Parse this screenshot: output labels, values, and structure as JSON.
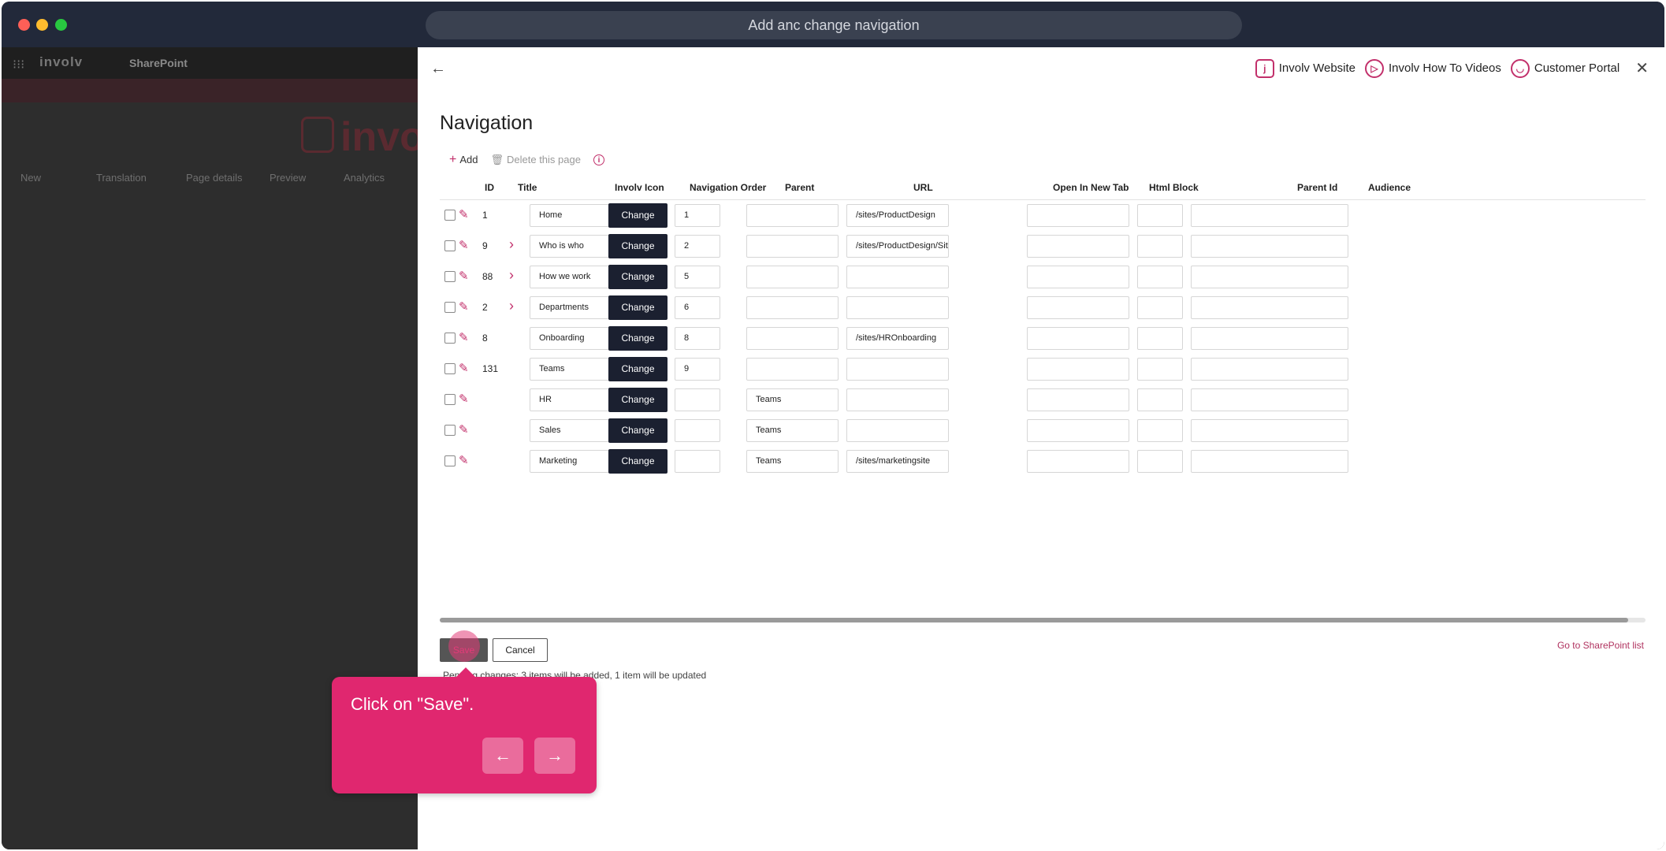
{
  "window": {
    "address": "Add anc change navigation"
  },
  "sharepoint": {
    "logo": "involv",
    "site": "SharePoint",
    "big_logo": "invo",
    "commands": [
      "New",
      "Translation",
      "Page details",
      "Preview",
      "Analytics"
    ]
  },
  "panel": {
    "links": [
      {
        "label": "Involv Website",
        "icon": "involv-logo-icon"
      },
      {
        "label": "Involv How To Videos",
        "icon": "play-icon"
      },
      {
        "label": "Customer Portal",
        "icon": "user-icon"
      }
    ],
    "title": "Navigation",
    "commands": {
      "add": "Add",
      "delete": "Delete this page"
    }
  },
  "table": {
    "columns": [
      "ID",
      "Title",
      "Involv Icon",
      "Navigation Order",
      "Parent",
      "URL",
      "Open In New Tab",
      "Html Block",
      "Parent Id",
      "Audience"
    ],
    "change_label": "Change",
    "rows": [
      {
        "id": "1",
        "expandable": false,
        "title": "Home",
        "icon": "home-icon",
        "order": "1",
        "parent": "",
        "url": "/sites/ProductDesign",
        "new_tab": false
      },
      {
        "id": "9",
        "expandable": true,
        "title": "Who is who",
        "icon": "",
        "order": "2",
        "parent": "",
        "url": "/sites/ProductDesign/SitePag",
        "new_tab": false
      },
      {
        "id": "88",
        "expandable": true,
        "title": "How we work",
        "icon": "",
        "order": "5",
        "parent": "",
        "url": "",
        "new_tab": false
      },
      {
        "id": "2",
        "expandable": true,
        "title": "Departments",
        "icon": "",
        "order": "6",
        "parent": "",
        "url": "",
        "new_tab": false
      },
      {
        "id": "8",
        "expandable": false,
        "title": "Onboarding",
        "icon": "",
        "order": "8",
        "parent": "",
        "url": "/sites/HROnboarding",
        "new_tab": true
      },
      {
        "id": "131",
        "expandable": false,
        "title": "Teams",
        "icon": "",
        "order": "9",
        "parent": "",
        "url": "",
        "new_tab": false
      },
      {
        "id": "",
        "expandable": false,
        "title": "HR",
        "icon": "",
        "order": "",
        "parent": "Teams",
        "url": "",
        "new_tab": false
      },
      {
        "id": "",
        "expandable": false,
        "title": "Sales",
        "icon": "",
        "order": "",
        "parent": "Teams",
        "url": "",
        "new_tab": false
      },
      {
        "id": "",
        "expandable": false,
        "title": "Marketing",
        "icon": "at-icon",
        "order": "",
        "parent": "Teams",
        "url": "/sites/marketingsite",
        "new_tab": false
      }
    ]
  },
  "footer": {
    "save": "Save",
    "cancel": "Cancel",
    "status": "Pending changes: 3 items will be added, 1 item will be updated",
    "goto": "Go to SharePoint list"
  },
  "tooltip": {
    "text": "Click on \"Save\".",
    "prev": "←",
    "next": "→"
  },
  "colors": {
    "accent": "#c2306b",
    "tooltip": "#e0276f",
    "button_dark": "#1b2030"
  }
}
